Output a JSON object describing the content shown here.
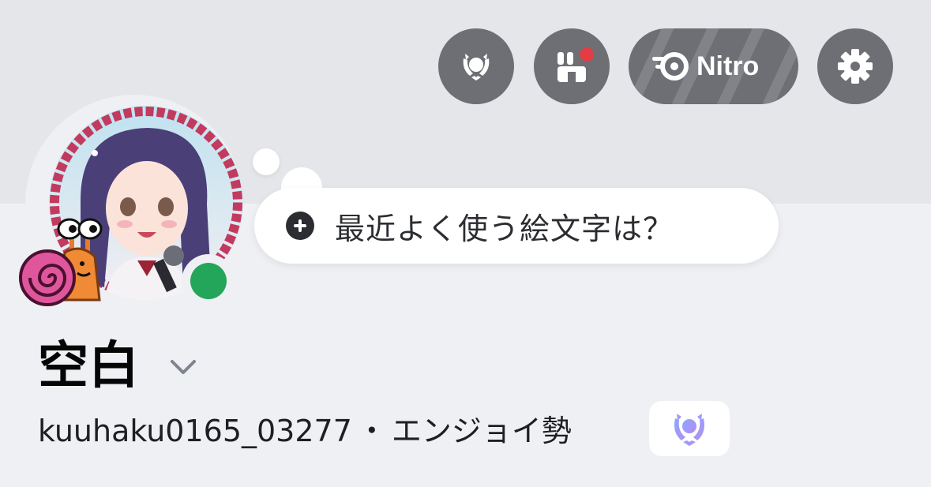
{
  "header": {
    "buttons": {
      "badge": "laurel-badge-icon",
      "shop": "shop-icon",
      "nitro_label": "Nitro",
      "settings": "gear-icon"
    },
    "shop_notification_color": "#e23d44"
  },
  "profile": {
    "status_color": "#23a55a",
    "status_prompt": "最近よく使う絵文字は？",
    "display_name": "空白",
    "username": "kuuhaku0165_03277",
    "separator": "・",
    "pronoun_tag": "エンジョイ勢",
    "badge_icon": "laurel-wreath-icon"
  },
  "colors": {
    "button_bg": "#6d6f74",
    "banner": "#e4e6ea",
    "background": "#eef0f3",
    "online": "#23a55a"
  }
}
